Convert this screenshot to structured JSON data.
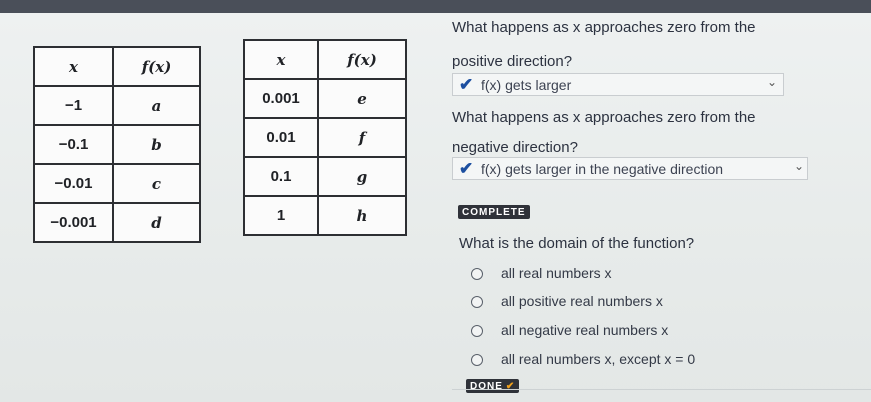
{
  "table1": {
    "headers": [
      "x",
      "f(x)"
    ],
    "rows": [
      [
        "−1",
        "a"
      ],
      [
        "−0.1",
        "b"
      ],
      [
        "−0.01",
        "c"
      ],
      [
        "−0.001",
        "d"
      ]
    ]
  },
  "table2": {
    "headers": [
      "x",
      "f(x)"
    ],
    "rows": [
      [
        "0.001",
        "e"
      ],
      [
        "0.01",
        "f"
      ],
      [
        "0.1",
        "g"
      ],
      [
        "1",
        "h"
      ]
    ]
  },
  "q1": {
    "line1": "What happens as x approaches zero from the",
    "line2": "positive direction?",
    "answer": "f(x) gets larger"
  },
  "q2": {
    "line1": "What happens as x approaches zero from the",
    "line2": "negative direction?",
    "answer": "f(x) gets larger in the negative direction"
  },
  "complete_badge": "COMPLETE",
  "q3": {
    "question": "What is the domain of the function?",
    "options": [
      "all real numbers x",
      "all positive real numbers x",
      "all negative real numbers x",
      "all real numbers x, except x = 0"
    ]
  },
  "done_badge": "DONE",
  "icons": {
    "check": "checkmark-icon",
    "chevron": "chevron-down-icon",
    "radio": "radio-circle"
  }
}
